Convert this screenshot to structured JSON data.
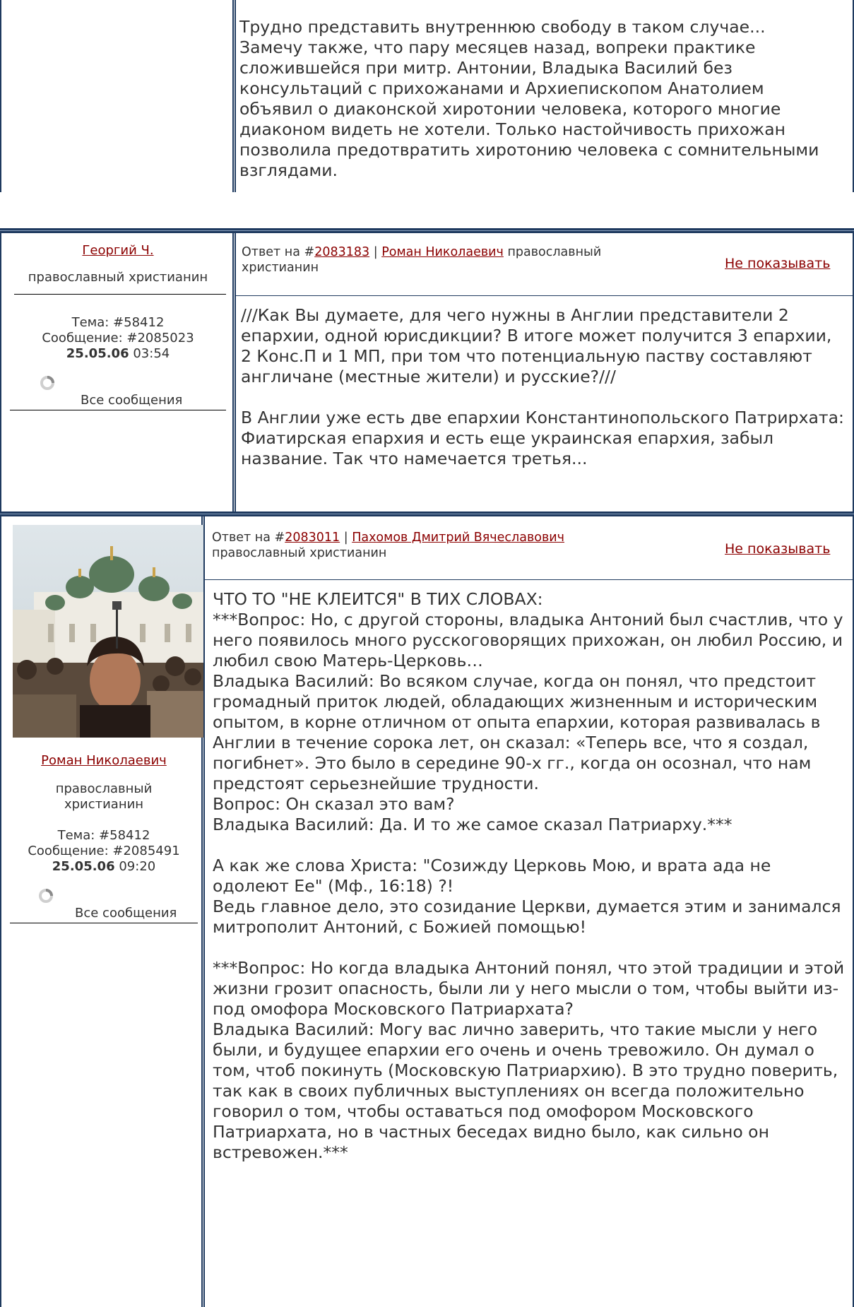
{
  "post_top": {
    "body": "Трудно представить внутреннюю свободу в таком случае...\nЗамечу также, что пару месяцев назад, вопреки практике сложившейся при митр. Антонии, Владыка Василий без консультаций с прихожанами и Архиепископом Анатолием объявил о диаконской хиротонии человека, которого многие диаконом видеть не хотели. Только настойчивость прихожан позволила предотвратить хиротонию человека с сомнительными взглядами."
  },
  "post_georgy": {
    "author": "Георгий Ч.",
    "role": "православный христианин",
    "topic": "Тема: #58412",
    "message": "Сообщение: #2085023",
    "date": "25.05.06",
    "time": "03:54",
    "all_messages": "Все сообщения",
    "reply_prefix": "Ответ на #",
    "reply_id": "2083183",
    "reply_sep": " | ",
    "reply_author": "Роман Николаевич",
    "reply_author_role": " православный христианин",
    "hide": "Не показывать",
    "body": "///Как Вы думаете, для чего нужны в Англии представители 2 епархии, одной юрисдикции? В итоге может получится 3 епархии, 2 Конс.П и 1 МП, при том что потенциальную паству составляют англичане (местные жители) и русские?///\n\nВ Англии уже есть две епархии Константинопольского Патрирхата: Фиатирская епархия и есть еще украинская епархия, забыл название. Так что намечается третья..."
  },
  "post_roman": {
    "author": "Роман Николаевич",
    "role": "православный христианин",
    "topic": "Тема: #58412",
    "message": "Сообщение: #2085491",
    "date": "25.05.06",
    "time": "09:20",
    "all_messages": "Все сообщения",
    "reply_prefix": "Ответ на #",
    "reply_id": "2083011",
    "reply_sep": " | ",
    "reply_author": "Пахомов Дмитрий Вячеславович",
    "reply_author_role": " православный христианин",
    "hide": "Не показывать",
    "body": "ЧТО ТО \"НЕ КЛЕИТСЯ\" В ТИХ СЛОВАХ:\n***Вопрос: Но, с другой стороны, владыка Антоний был счастлив, что у него появилось много русскоговорящих прихожан, он любил Россию, и любил свою Матерь-Церковь…\nВладыка Василий: Во всяком случае, когда он понял, что предстоит громадный приток людей, обладающих жизненным и историческим опытом, в корне отличном от опыта епархии, которая развивалась в Англии в течение сорока лет, он сказал: «Теперь все, что я создал, погибнет». Это было в середине 90-х гг., когда он осознал, что нам предстоят серьезнейшие трудности.\nВопрос: Он сказал это вам?\nВладыка Василий: Да. И то же самое сказал Патриарху.***\n\nА как же слова Христа: \"Созижду Церковь Мою, и врата ада не одолеют Ее\" (Мф., 16:18) ?!\nВедь главное дело, это созидание Церкви, думается этим и занимался митрополит Антоний, с Божией помощью!\n\n***Вопрос: Но когда владыка Антоний понял, что этой традиции и этой жизни грозит опасность, были ли у него мысли о том, чтобы выйти из-под омофора Московского Патриархата?\nВладыка Василий: Могу вас лично заверить, что такие мысли у него были, и будущее епархии его очень и очень тревожило. Он думал о том, чтоб покинуть (Московскую Патриархию). В это трудно поверить, так как в своих публичных выступлениях он всегда положительно говорил о том, чтобы оставаться под омофором Московского Патриархата, но в частных беседах видно было, как сильно он встревожен.***"
  }
}
